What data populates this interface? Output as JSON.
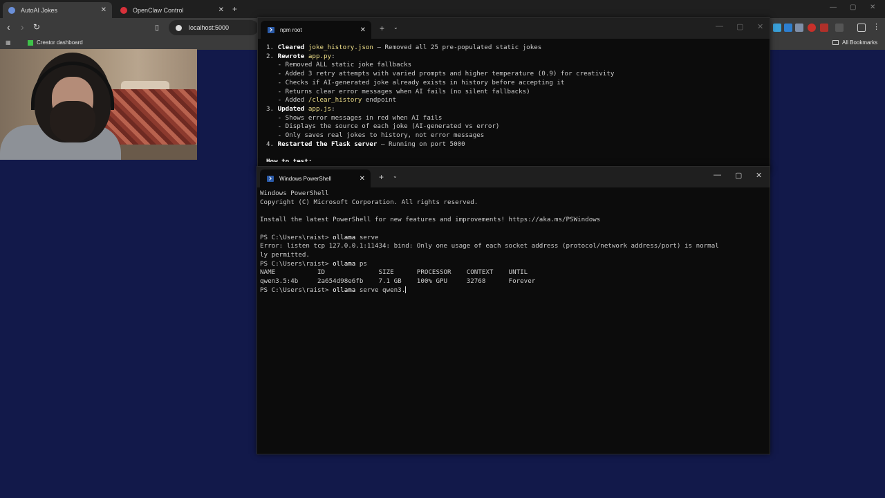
{
  "browser": {
    "tabs": [
      {
        "label": "AutoAI Jokes",
        "active": true,
        "favicon_color": "#6a8fd8"
      },
      {
        "label": "OpenClaw Control",
        "active": false,
        "favicon_color": "#d8313a"
      }
    ],
    "url": "localhost:5000",
    "bookmarks": {
      "creator": "Creator dashboard",
      "all": "All Bookmarks"
    }
  },
  "npm_window": {
    "tab_title": "npm root",
    "lines": [
      {
        "num": "1.",
        "bold": "Cleared ",
        "hl": "joke_history.json",
        "rest": " – Removed all 25 pre-populated static jokes"
      },
      {
        "num": "2.",
        "bold": "Rewrote ",
        "hl": "app.py",
        "rest": ":"
      },
      {
        "indent": "- Removed ALL static joke fallbacks"
      },
      {
        "indent": "- Added 3 retry attempts with varied prompts and higher temperature (0.9) for creativity"
      },
      {
        "indent": "- Checks if AI-generated joke already exists in history before accepting it"
      },
      {
        "indent": "- Returns clear error messages when AI fails (no silent fallbacks)"
      },
      {
        "indent_pre": "- Added ",
        "indent_hl": "/clear_history",
        "indent_post": " endpoint"
      },
      {
        "num": "3.",
        "bold": "Updated ",
        "hl": "app.js",
        "rest": ":"
      },
      {
        "indent": "- Shows error messages in red when AI fails"
      },
      {
        "indent": "- Displays the source of each joke (AI-generated vs error)"
      },
      {
        "indent": "- Only saves real jokes to history, not error messages"
      },
      {
        "num": "4.",
        "bold": "Restarted the Flask server",
        "hl": "",
        "rest": " – Running on port 5000"
      }
    ],
    "partial_line": "How to test:"
  },
  "ps_window": {
    "tab_title": "Windows PowerShell",
    "lines": [
      {
        "text": "Windows PowerShell"
      },
      {
        "text": "Copyright (C) Microsoft Corporation. All rights reserved."
      },
      {
        "text": ""
      },
      {
        "text": "Install the latest PowerShell for new features and improvements! https://aka.ms/PSWindows"
      },
      {
        "text": ""
      },
      {
        "prompt": "PS C:\\Users\\raist> ",
        "cmd": "ollama",
        "args": " serve"
      },
      {
        "text": "Error: listen tcp 127.0.0.1:11434: bind: Only one usage of each socket address (protocol/network address/port) is normal"
      },
      {
        "text": "ly permitted."
      },
      {
        "prompt": "PS C:\\Users\\raist> ",
        "cmd": "ollama",
        "args": " ps"
      },
      {
        "text": "NAME           ID              SIZE      PROCESSOR    CONTEXT    UNTIL"
      },
      {
        "text": "qwen3.5:4b     2a654d98e6fb    7.1 GB    100% GPU     32768      Forever"
      },
      {
        "prompt": "PS C:\\Users\\raist> ",
        "cmd": "ollama",
        "args": " serve qwen3.",
        "cursor": true
      }
    ]
  }
}
